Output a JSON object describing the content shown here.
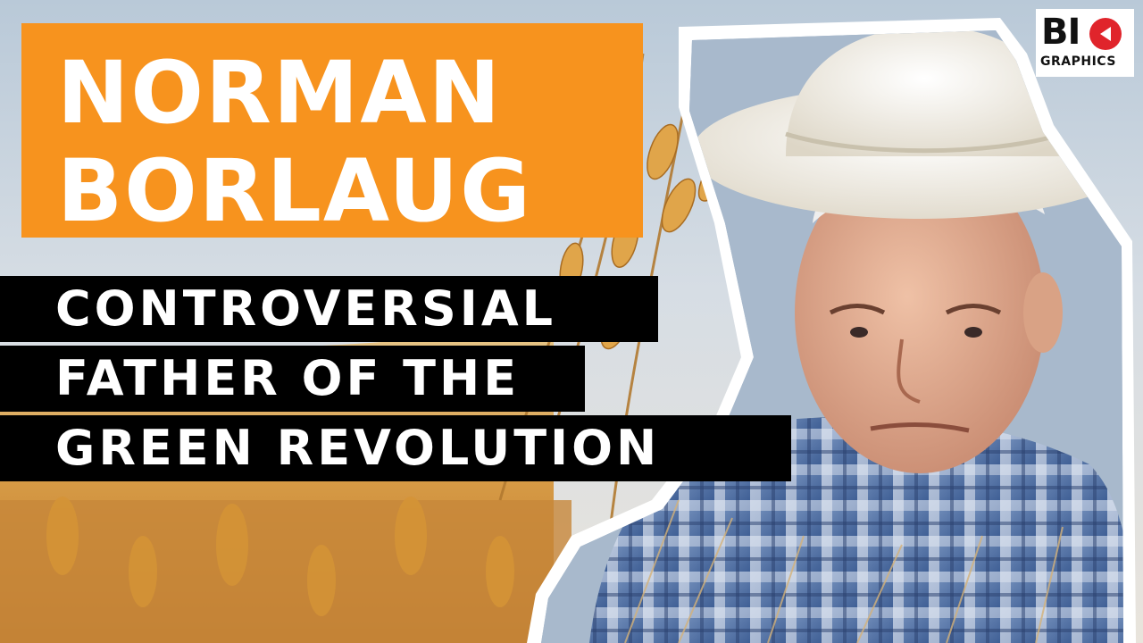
{
  "thumbnail": {
    "title_line_1": "NORMAN",
    "title_line_2": "BORLAUG",
    "subtitle_line_1": "CONTROVERSIAL",
    "subtitle_line_2": "FATHER OF THE",
    "subtitle_line_3": "GREEN REVOLUTION"
  },
  "logo": {
    "top_text": "BI",
    "bottom_text": "GRAPHICS",
    "icon": "play-icon"
  },
  "photo": {
    "subject": "portrait-photo",
    "background": "wheat-field"
  },
  "colors": {
    "title_box": "#f7931e",
    "subtitle_bar": "#000000",
    "text": "#ffffff",
    "logo_accent": "#e0242b",
    "cutout_border": "#ffffff"
  }
}
